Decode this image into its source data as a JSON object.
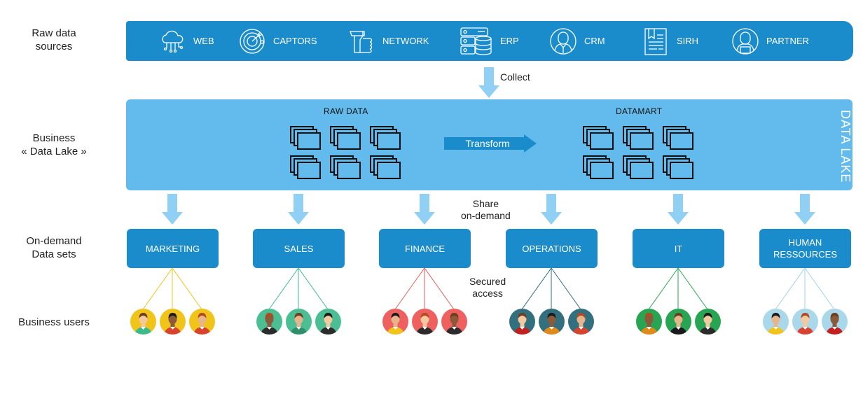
{
  "rows": {
    "raw_sources": "Raw data\nsources",
    "data_lake": "Business\n« Data Lake »",
    "datasets": "On-demand\nData sets",
    "users": "Business users"
  },
  "sources": [
    {
      "label": "WEB",
      "icon": "cloud-network-icon"
    },
    {
      "label": "CAPTORS",
      "icon": "radar-icon"
    },
    {
      "label": "NETWORK",
      "icon": "thumbs-up-icon"
    },
    {
      "label": "ERP",
      "icon": "server-database-icon"
    },
    {
      "label": "CRM",
      "icon": "businessman-icon"
    },
    {
      "label": "SIRH",
      "icon": "document-bookmark-icon"
    },
    {
      "label": "PARTNER",
      "icon": "partner-person-icon"
    }
  ],
  "collect_label": "Collect",
  "lake": {
    "title": "DATA LAKE",
    "raw_data_title": "RAW DATA",
    "datamart_title": "DATAMART",
    "transform_label": "Transform"
  },
  "share_label": "Share\non-demand",
  "secured_label": "Secured\naccess",
  "departments": [
    {
      "label": "MARKETING",
      "line_color": "#f0c419",
      "avatar_bg": "#f0c419"
    },
    {
      "label": "SALES",
      "line_color": "#3dba8c",
      "avatar_bg": "#4cbe94"
    },
    {
      "label": "FINANCE",
      "line_color": "#ee5a5a",
      "avatar_bg": "#ef6161"
    },
    {
      "label": "OPERATIONS",
      "line_color": "#2e6b80",
      "avatar_bg": "#32707f"
    },
    {
      "label": "IT",
      "line_color": "#27a552",
      "avatar_bg": "#27a552"
    },
    {
      "label": "HUMAN\nRESSOURCES",
      "line_color": "#9fd3e6",
      "avatar_bg": "#a8d8ea"
    }
  ],
  "colors": {
    "primary": "#1a8ccb",
    "lake": "#62bbec",
    "arrow": "#8fd0f4"
  }
}
